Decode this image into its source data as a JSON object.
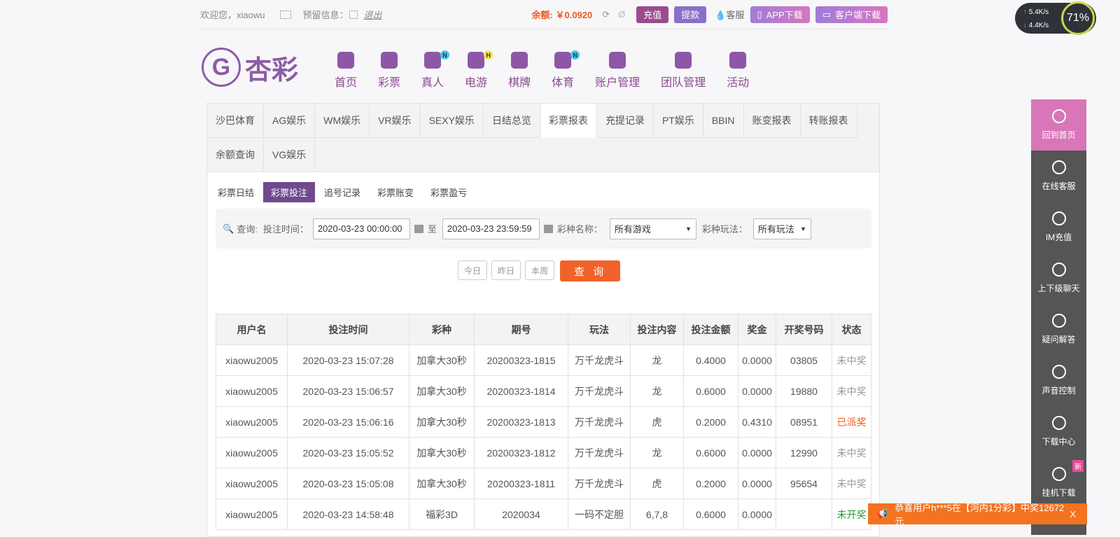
{
  "top": {
    "welcome": "欢迎您，xiaowu",
    "message_label": "预留信息：",
    "logout": "退出",
    "balance": "余额: ￥0.0920",
    "deposit": "充值",
    "withdraw": "提款",
    "service": "客服",
    "app_download": "APP下载",
    "client_download": "客户端下载"
  },
  "logo": {
    "text": "杏彩"
  },
  "nav": [
    {
      "label": "首页"
    },
    {
      "label": "彩票"
    },
    {
      "label": "真人",
      "badge": "N"
    },
    {
      "label": "电游",
      "badge": "H"
    },
    {
      "label": "棋牌"
    },
    {
      "label": "体育",
      "badge": "N"
    },
    {
      "label": "账户管理"
    },
    {
      "label": "团队管理"
    },
    {
      "label": "活动"
    }
  ],
  "tabs": [
    "沙巴体育",
    "AG娱乐",
    "WM娱乐",
    "VR娱乐",
    "SEXY娱乐",
    "日结总览",
    "彩票报表",
    "充提记录",
    "PT娱乐",
    "BBIN",
    "账变报表",
    "转账报表",
    "余额查询",
    "VG娱乐"
  ],
  "active_tab": "彩票报表",
  "subtabs": [
    "彩票日结",
    "彩票投注",
    "追号记录",
    "彩票账变",
    "彩票盈亏"
  ],
  "active_subtab": "彩票投注",
  "query": {
    "label": "查询:",
    "time_label": "投注时间：",
    "start": "2020-03-23 00:00:00",
    "to": "至",
    "end": "2020-03-23 23:59:59",
    "game_label": "彩种名称：",
    "game": "所有游戏",
    "play_label": "彩种玩法：",
    "play": "所有玩法",
    "today": "今日",
    "yesterday": "昨日",
    "week": "本周",
    "submit": "查 询"
  },
  "table": {
    "headers": [
      "用户名",
      "投注时间",
      "彩种",
      "期号",
      "玩法",
      "投注内容",
      "投注金额",
      "奖金",
      "开奖号码",
      "状态"
    ],
    "rows": [
      [
        "xiaowu2005",
        "2020-03-23 15:07:28",
        "加拿大30秒",
        "20200323-1815",
        "万千龙虎斗",
        "龙",
        "0.4000",
        "0.0000",
        "03805",
        "未中奖"
      ],
      [
        "xiaowu2005",
        "2020-03-23 15:06:57",
        "加拿大30秒",
        "20200323-1814",
        "万千龙虎斗",
        "龙",
        "0.6000",
        "0.0000",
        "19880",
        "未中奖"
      ],
      [
        "xiaowu2005",
        "2020-03-23 15:06:16",
        "加拿大30秒",
        "20200323-1813",
        "万千龙虎斗",
        "虎",
        "0.2000",
        "0.4310",
        "08951",
        "已派奖"
      ],
      [
        "xiaowu2005",
        "2020-03-23 15:05:52",
        "加拿大30秒",
        "20200323-1812",
        "万千龙虎斗",
        "龙",
        "0.6000",
        "0.0000",
        "12990",
        "未中奖"
      ],
      [
        "xiaowu2005",
        "2020-03-23 15:05:08",
        "加拿大30秒",
        "20200323-1811",
        "万千龙虎斗",
        "虎",
        "0.2000",
        "0.0000",
        "95654",
        "未中奖"
      ],
      [
        "xiaowu2005",
        "2020-03-23 14:58:48",
        "福彩3D",
        "2020034",
        "一码不定胆",
        "6,7,8",
        "0.6000",
        "0.0000",
        "",
        "未开奖"
      ]
    ]
  },
  "status_colors": {
    "未中奖": "#999999",
    "已派奖": "#f05a1a",
    "未开奖": "#2a9d2a"
  },
  "sidebar": [
    {
      "label": "回到首页"
    },
    {
      "label": "在线客服"
    },
    {
      "label": "IM充值"
    },
    {
      "label": "上下级聊天"
    },
    {
      "label": "疑问解答"
    },
    {
      "label": "声音控制"
    },
    {
      "label": "下载中心"
    },
    {
      "label": "挂机下载",
      "badge": "新"
    }
  ],
  "speed": {
    "up": "5.4K/s",
    "down": "4.4K/s",
    "percent": "71%"
  },
  "marquee": {
    "text": "恭喜用户h***5在【河内1分彩】中奖12672元",
    "close": "X"
  }
}
